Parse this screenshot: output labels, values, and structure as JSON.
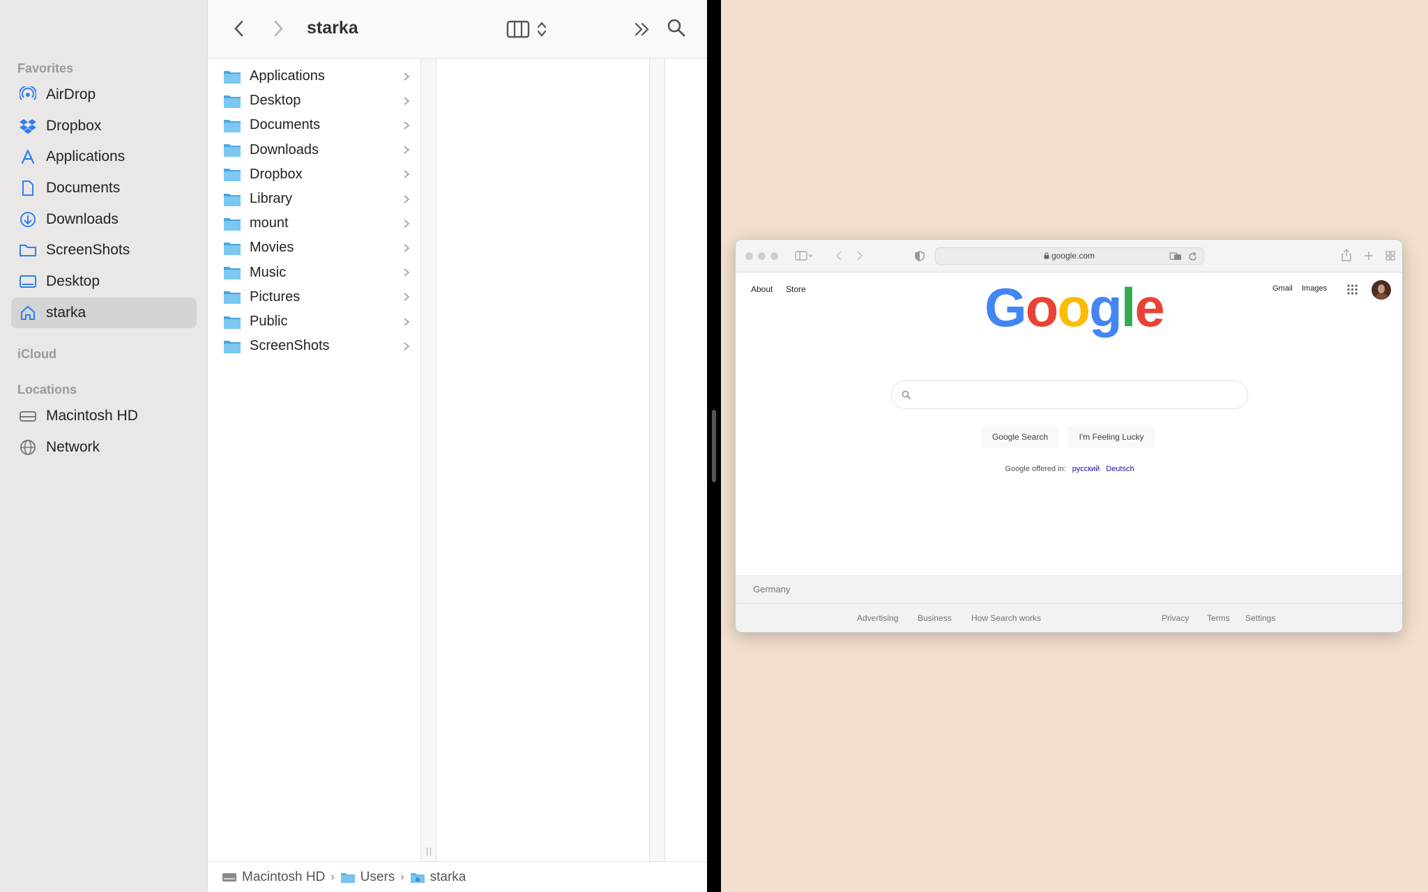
{
  "sidebar": {
    "favorites_title": "Favorites",
    "items": [
      {
        "label": "AirDrop",
        "icon": "airdrop-icon"
      },
      {
        "label": "Dropbox",
        "icon": "dropbox-icon"
      },
      {
        "label": "Applications",
        "icon": "applications-icon"
      },
      {
        "label": "Documents",
        "icon": "document-icon"
      },
      {
        "label": "Downloads",
        "icon": "download-icon"
      },
      {
        "label": "ScreenShots",
        "icon": "folder-icon"
      },
      {
        "label": "Desktop",
        "icon": "desktop-icon"
      },
      {
        "label": "starka",
        "icon": "home-icon",
        "selected": true
      }
    ],
    "icloud_title": "iCloud",
    "locations_title": "Locations",
    "locations": [
      {
        "label": "Macintosh HD",
        "icon": "hard-drive-icon"
      },
      {
        "label": "Network",
        "icon": "network-icon"
      }
    ]
  },
  "finder": {
    "title": "starka",
    "folders": [
      "Applications",
      "Desktop",
      "Documents",
      "Downloads",
      "Dropbox",
      "Library",
      "mount",
      "Movies",
      "Music",
      "Pictures",
      "Public",
      "ScreenShots"
    ],
    "path": [
      "Macintosh HD",
      "Users",
      "starka"
    ]
  },
  "safari": {
    "url": "google.com"
  },
  "google": {
    "top_left": [
      "About",
      "Store"
    ],
    "top_right": [
      "Gmail",
      "Images"
    ],
    "logo": [
      "G",
      "o",
      "o",
      "g",
      "l",
      "e"
    ],
    "logo_colors": [
      "#4285F4",
      "#EA4335",
      "#FBBC05",
      "#4285F4",
      "#34A853",
      "#EA4335"
    ],
    "search_button": "Google Search",
    "lucky_button": "I'm Feeling Lucky",
    "offered_in": "Google offered in:",
    "languages": [
      "русский",
      "Deutsch"
    ],
    "country": "Germany",
    "footer_left": [
      "Advertising",
      "Business",
      "How Search works"
    ],
    "footer_right": [
      "Privacy",
      "Terms",
      "Settings"
    ]
  },
  "colors": {
    "desktop_bg": "#f2dfcc",
    "finder_folder": "#5ab3e8",
    "sidebar_icon": "#2f7df6"
  }
}
